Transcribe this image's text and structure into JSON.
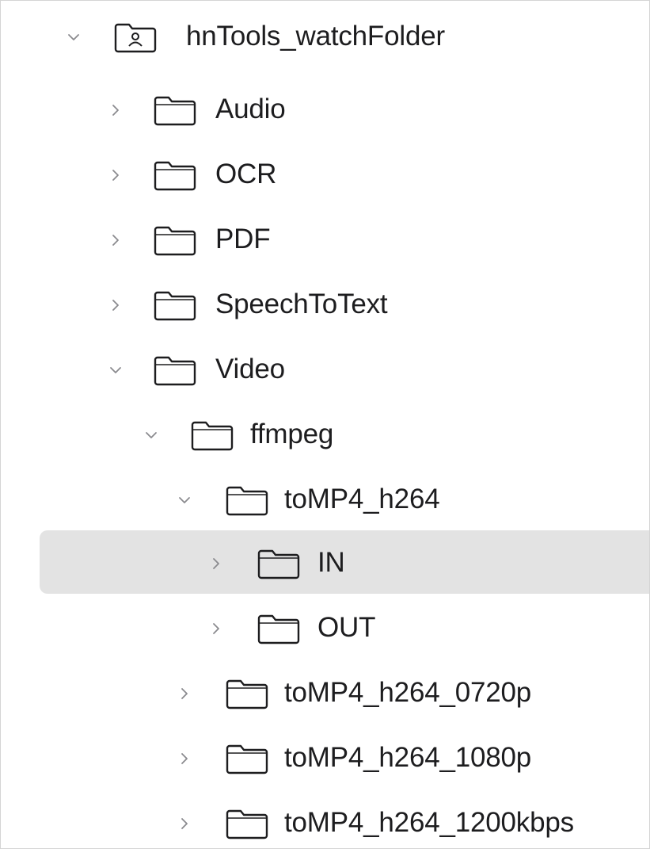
{
  "tree": {
    "root": {
      "label": "hnTools_watchFolder",
      "icon": "user-folder-icon",
      "expanded": true
    },
    "items": [
      {
        "label": "Audio",
        "icon": "folder-icon",
        "expanded": false,
        "selected": false
      },
      {
        "label": "OCR",
        "icon": "folder-icon",
        "expanded": false,
        "selected": false
      },
      {
        "label": "PDF",
        "icon": "folder-icon",
        "expanded": false,
        "selected": false
      },
      {
        "label": "SpeechToText",
        "icon": "folder-icon",
        "expanded": false,
        "selected": false
      },
      {
        "label": "Video",
        "icon": "folder-icon",
        "expanded": true,
        "selected": false
      },
      {
        "label": "ffmpeg",
        "icon": "folder-icon",
        "expanded": true,
        "selected": false
      },
      {
        "label": "toMP4_h264",
        "icon": "folder-icon",
        "expanded": true,
        "selected": false
      },
      {
        "label": "IN",
        "icon": "folder-icon",
        "expanded": false,
        "selected": true
      },
      {
        "label": "OUT",
        "icon": "folder-icon",
        "expanded": false,
        "selected": false
      },
      {
        "label": "toMP4_h264_0720p",
        "icon": "folder-icon",
        "expanded": false,
        "selected": false
      },
      {
        "label": "toMP4_h264_1080p",
        "icon": "folder-icon",
        "expanded": false,
        "selected": false
      },
      {
        "label": "toMP4_h264_1200kbps",
        "icon": "folder-icon",
        "expanded": false,
        "selected": false
      }
    ]
  },
  "colors": {
    "selection": "#e3e3e3",
    "text": "#1d1d1f",
    "icon_stroke": "#1d1d1f",
    "chevron": "#8a8a8e"
  }
}
